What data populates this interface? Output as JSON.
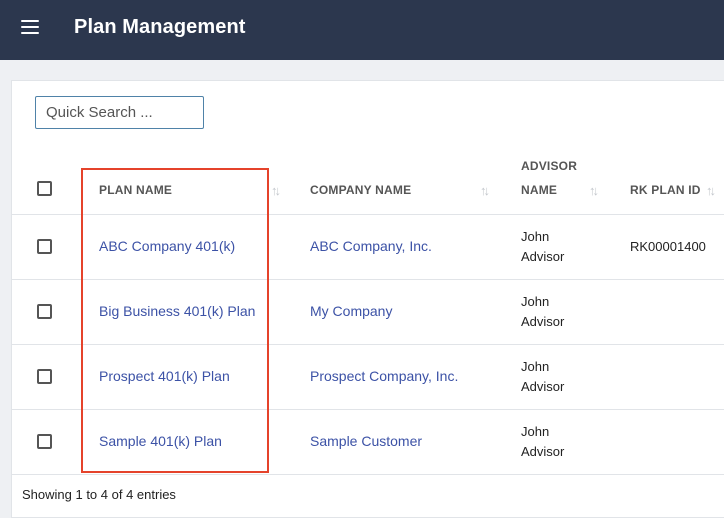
{
  "header": {
    "title": "Plan Management",
    "menu_icon": "hamburger-menu-icon",
    "background": "#2c374e"
  },
  "search": {
    "placeholder": "Quick Search ..."
  },
  "table": {
    "columns": {
      "plan_name": "PLAN NAME",
      "company_name": "COMPANY NAME",
      "advisor_line1": "ADVISOR",
      "advisor_line2": "NAME",
      "rk_plan_id": "RK PLAN ID"
    },
    "sort_glyph": "↑↓",
    "rows": [
      {
        "plan_name": "ABC Company 401(k)",
        "company_name": "ABC Company, Inc.",
        "advisor_first": "John",
        "advisor_last": "Advisor",
        "rk_plan_id": "RK00001400"
      },
      {
        "plan_name": "Big Business 401(k) Plan",
        "company_name": "My Company",
        "advisor_first": "John",
        "advisor_last": "Advisor",
        "rk_plan_id": ""
      },
      {
        "plan_name": "Prospect 401(k) Plan",
        "company_name": "Prospect Company, Inc.",
        "advisor_first": "John",
        "advisor_last": "Advisor",
        "rk_plan_id": ""
      },
      {
        "plan_name": "Sample 401(k) Plan",
        "company_name": "Sample Customer",
        "advisor_first": "John",
        "advisor_last": "Advisor",
        "rk_plan_id": ""
      }
    ]
  },
  "footer": {
    "info": "Showing 1 to 4 of 4 entries"
  },
  "colors": {
    "link": "#3c52a6",
    "highlight": "#e5432b",
    "search_border": "#4f82a8"
  }
}
